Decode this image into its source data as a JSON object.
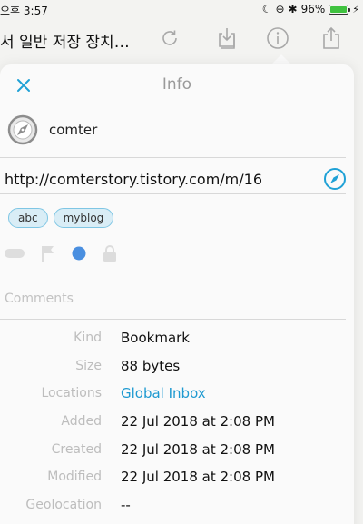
{
  "status": {
    "time": "오후 3:57",
    "battery_percent": "96%",
    "battery_level": 0.96,
    "battery_color": "#3fc23f"
  },
  "toolbar": {
    "title": "서 일반 저장 장치…",
    "icons": [
      "refresh-icon",
      "download-icon",
      "info-icon",
      "share-icon"
    ]
  },
  "popover": {
    "title": "Info",
    "close_icon": "close-icon",
    "site": {
      "name": "comter",
      "icon": "safari-compass-icon"
    },
    "url": "http://comterstory.tistory.com/m/16",
    "tags": [
      "abc",
      "myblog"
    ],
    "flags": [
      "toggle-icon",
      "flag-icon",
      "blue-dot-icon",
      "lock-icon"
    ],
    "comments_placeholder": "Comments",
    "meta": [
      {
        "key": "Kind",
        "value": "Bookmark",
        "link": false
      },
      {
        "key": "Size",
        "value": "88 bytes",
        "link": false
      },
      {
        "key": "Locations",
        "value": "Global Inbox",
        "link": true
      },
      {
        "key": "Added",
        "value": "22 Jul 2018 at 2:08 PM",
        "link": false
      },
      {
        "key": "Created",
        "value": "22 Jul 2018 at 2:08 PM",
        "link": false
      },
      {
        "key": "Modified",
        "value": "22 Jul 2018 at 2:08 PM",
        "link": false
      },
      {
        "key": "Geolocation",
        "value": "--",
        "link": false
      }
    ]
  },
  "colors": {
    "accent": "#1fa1d6",
    "link": "#1f9ad1",
    "tag_fill": "#d9edf6",
    "tag_border": "#7fc6e4",
    "dot": "#4a8fe0"
  }
}
